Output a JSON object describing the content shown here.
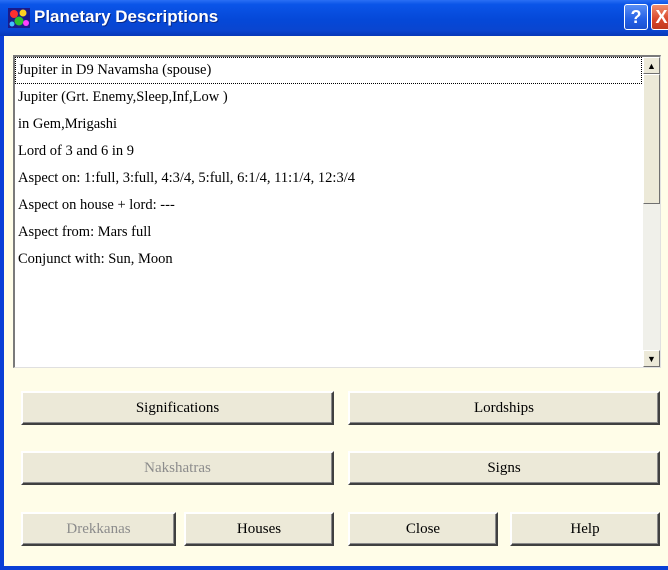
{
  "window": {
    "title": "Planetary Descriptions",
    "help_glyph": "?",
    "close_glyph": "X"
  },
  "list": {
    "items": [
      "Jupiter in D9 Navamsha  (spouse)",
      "Jupiter (Grt. Enemy,Sleep,Inf,Low )",
      "in Gem,Mrigashi",
      "Lord of 3 and 6 in 9",
      "Aspect on:  1:full, 3:full, 4:3/4, 5:full, 6:1/4, 11:1/4, 12:3/4",
      "Aspect on house + lord:  ---",
      "Aspect from:  Mars full",
      "Conjunct with:  Sun,  Moon"
    ],
    "selected_index": 0
  },
  "buttons": {
    "significations": "Significations",
    "lordships": "Lordships",
    "nakshatras": "Nakshatras",
    "signs": "Signs",
    "drekkanas": "Drekkanas",
    "houses": "Houses",
    "close": "Close",
    "help": "Help"
  },
  "colors": {
    "titlebar": "#0548d8",
    "client_background": "#fffde8",
    "button_face": "#ece9d8",
    "disabled_text": "#8c8c8c"
  }
}
